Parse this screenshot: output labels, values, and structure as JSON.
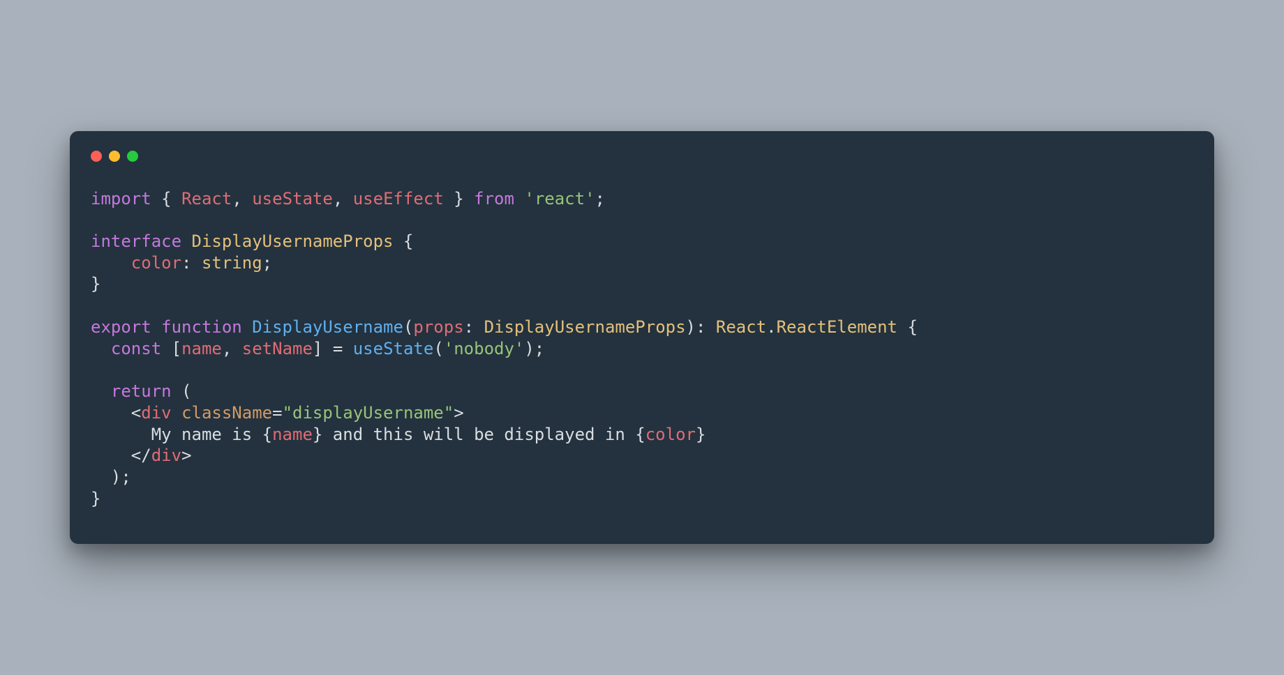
{
  "code": {
    "tokens": [
      {
        "t": "import",
        "c": "tok-kw"
      },
      {
        "t": " { ",
        "c": "tok-def"
      },
      {
        "t": "React",
        "c": "tok-prop"
      },
      {
        "t": ", ",
        "c": "tok-def"
      },
      {
        "t": "useState",
        "c": "tok-prop"
      },
      {
        "t": ", ",
        "c": "tok-def"
      },
      {
        "t": "useEffect",
        "c": "tok-prop"
      },
      {
        "t": " } ",
        "c": "tok-def"
      },
      {
        "t": "from",
        "c": "tok-kw"
      },
      {
        "t": " ",
        "c": "tok-def"
      },
      {
        "t": "'react'",
        "c": "tok-str"
      },
      {
        "t": ";",
        "c": "tok-def"
      },
      {
        "t": "\n",
        "c": ""
      },
      {
        "t": "\n",
        "c": ""
      },
      {
        "t": "interface",
        "c": "tok-kw"
      },
      {
        "t": " ",
        "c": "tok-def"
      },
      {
        "t": "DisplayUsernameProps",
        "c": "tok-type"
      },
      {
        "t": " {",
        "c": "tok-def"
      },
      {
        "t": "\n",
        "c": ""
      },
      {
        "t": "    ",
        "c": "tok-def"
      },
      {
        "t": "color",
        "c": "tok-prop"
      },
      {
        "t": ": ",
        "c": "tok-def"
      },
      {
        "t": "string",
        "c": "tok-type"
      },
      {
        "t": ";",
        "c": "tok-def"
      },
      {
        "t": "\n",
        "c": ""
      },
      {
        "t": "}",
        "c": "tok-def"
      },
      {
        "t": "\n",
        "c": ""
      },
      {
        "t": "\n",
        "c": ""
      },
      {
        "t": "export",
        "c": "tok-kw"
      },
      {
        "t": " ",
        "c": "tok-def"
      },
      {
        "t": "function",
        "c": "tok-kw"
      },
      {
        "t": " ",
        "c": "tok-def"
      },
      {
        "t": "DisplayUsername",
        "c": "tok-func"
      },
      {
        "t": "(",
        "c": "tok-def"
      },
      {
        "t": "props",
        "c": "tok-prop"
      },
      {
        "t": ": ",
        "c": "tok-def"
      },
      {
        "t": "DisplayUsernameProps",
        "c": "tok-type"
      },
      {
        "t": "): ",
        "c": "tok-def"
      },
      {
        "t": "React",
        "c": "tok-type"
      },
      {
        "t": ".",
        "c": "tok-def"
      },
      {
        "t": "ReactElement",
        "c": "tok-type"
      },
      {
        "t": " {",
        "c": "tok-def"
      },
      {
        "t": "\n",
        "c": ""
      },
      {
        "t": "  ",
        "c": "tok-def"
      },
      {
        "t": "const",
        "c": "tok-kw"
      },
      {
        "t": " [",
        "c": "tok-def"
      },
      {
        "t": "name",
        "c": "tok-prop"
      },
      {
        "t": ", ",
        "c": "tok-def"
      },
      {
        "t": "setName",
        "c": "tok-prop"
      },
      {
        "t": "] = ",
        "c": "tok-def"
      },
      {
        "t": "useState",
        "c": "tok-func"
      },
      {
        "t": "(",
        "c": "tok-def"
      },
      {
        "t": "'nobody'",
        "c": "tok-str"
      },
      {
        "t": ");",
        "c": "tok-def"
      },
      {
        "t": "\n",
        "c": ""
      },
      {
        "t": "\n",
        "c": ""
      },
      {
        "t": "  ",
        "c": "tok-def"
      },
      {
        "t": "return",
        "c": "tok-kw"
      },
      {
        "t": " (",
        "c": "tok-def"
      },
      {
        "t": "\n",
        "c": ""
      },
      {
        "t": "    <",
        "c": "tok-def"
      },
      {
        "t": "div",
        "c": "tok-prop"
      },
      {
        "t": " ",
        "c": "tok-def"
      },
      {
        "t": "className",
        "c": "tok-attrname"
      },
      {
        "t": "=",
        "c": "tok-def"
      },
      {
        "t": "\"displayUsername\"",
        "c": "tok-str"
      },
      {
        "t": ">",
        "c": "tok-def"
      },
      {
        "t": "\n",
        "c": ""
      },
      {
        "t": "      My name is ",
        "c": "tok-def"
      },
      {
        "t": "{",
        "c": "tok-def"
      },
      {
        "t": "name",
        "c": "tok-prop"
      },
      {
        "t": "}",
        "c": "tok-def"
      },
      {
        "t": " and this will be displayed in ",
        "c": "tok-def"
      },
      {
        "t": "{",
        "c": "tok-def"
      },
      {
        "t": "color",
        "c": "tok-prop"
      },
      {
        "t": "}",
        "c": "tok-def"
      },
      {
        "t": "\n",
        "c": ""
      },
      {
        "t": "    </",
        "c": "tok-def"
      },
      {
        "t": "div",
        "c": "tok-prop"
      },
      {
        "t": ">",
        "c": "tok-def"
      },
      {
        "t": "\n",
        "c": ""
      },
      {
        "t": "  );",
        "c": "tok-def"
      },
      {
        "t": "\n",
        "c": ""
      },
      {
        "t": "}",
        "c": "tok-def"
      }
    ]
  },
  "colors": {
    "window_bg": "#23323e",
    "page_bg": "#a9b2bc",
    "traffic_red": "#ff5f56",
    "traffic_yellow": "#ffbd2e",
    "traffic_green": "#27c93f"
  }
}
